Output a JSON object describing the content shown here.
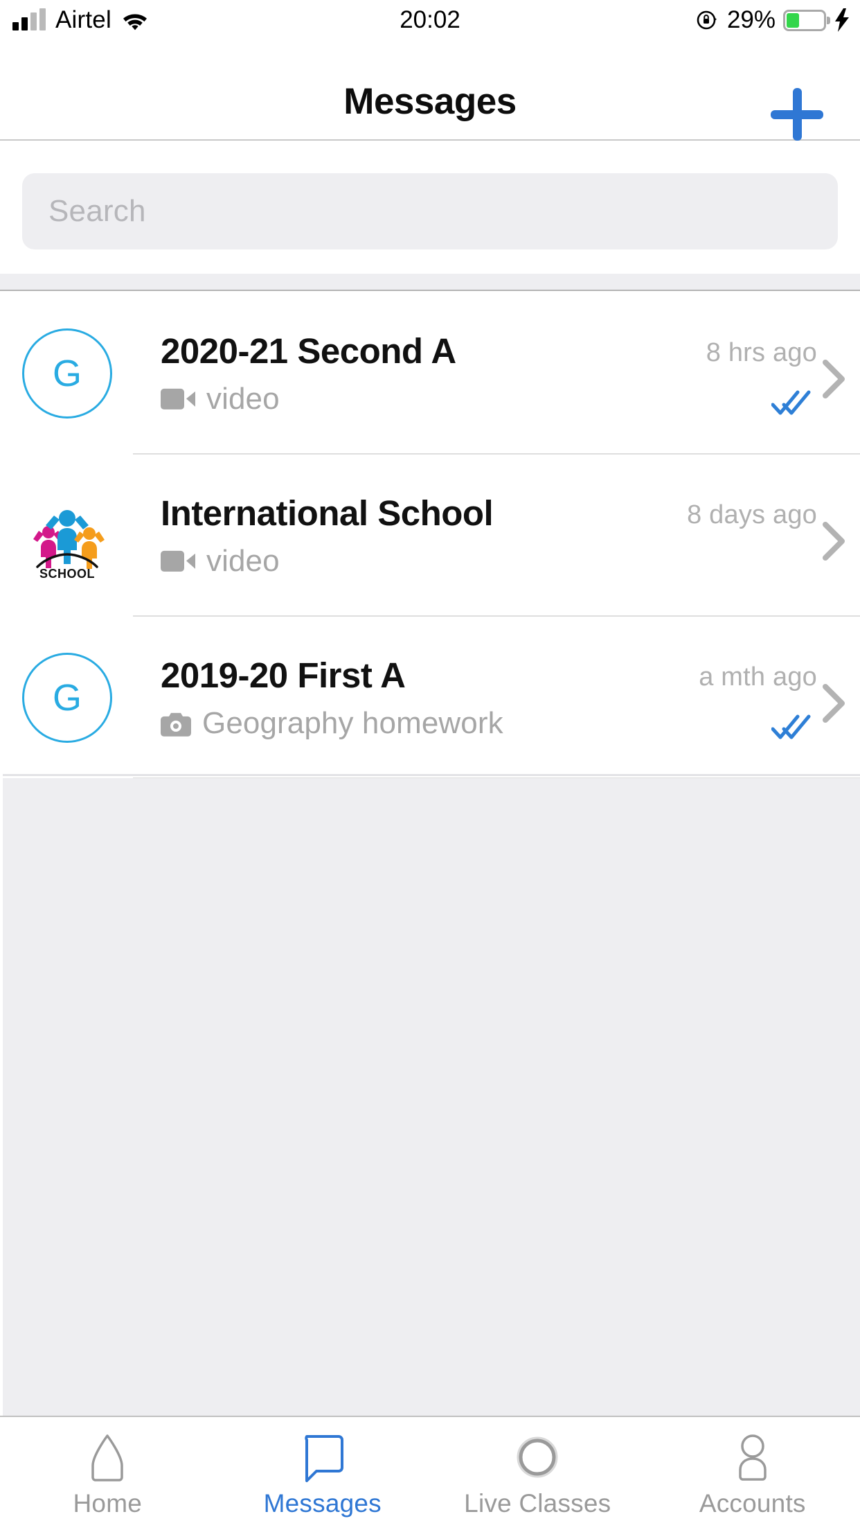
{
  "status_bar": {
    "carrier": "Airtel",
    "wifi_icon": "wifi-icon",
    "time": "20:02",
    "rotation_lock_icon": "rotation-lock-icon",
    "battery_percent": "29%",
    "battery_level": 29,
    "charging_icon": "lightning-bolt-icon"
  },
  "header": {
    "title": "Messages",
    "add_icon": "plus-icon"
  },
  "search": {
    "placeholder": "Search",
    "value": ""
  },
  "chats": [
    {
      "avatar_type": "letter",
      "avatar_letter": "G",
      "title": "2020-21 Second A",
      "attachment_icon": "video-icon",
      "preview": "video",
      "time": "8 hrs ago",
      "read_receipt": "double-check-icon",
      "has_receipt": true,
      "chevron_icon": "chevron-right-icon"
    },
    {
      "avatar_type": "logo",
      "avatar_logo": "school-logo-icon",
      "avatar_logo_text": "SCHOOL",
      "title": "International School",
      "attachment_icon": "video-icon",
      "preview": "video",
      "time": "8 days ago",
      "read_receipt": "",
      "has_receipt": false,
      "chevron_icon": "chevron-right-icon"
    },
    {
      "avatar_type": "letter",
      "avatar_letter": "G",
      "title": "2019-20 First A",
      "attachment_icon": "camera-icon",
      "preview": "Geography homework",
      "time": "a mth ago",
      "read_receipt": "double-check-icon",
      "has_receipt": true,
      "chevron_icon": "chevron-right-icon"
    }
  ],
  "tabbar": {
    "items": [
      {
        "label": "Home",
        "icon": "home-icon",
        "active": false
      },
      {
        "label": "Messages",
        "icon": "chat-bubble-icon",
        "active": true
      },
      {
        "label": "Live Classes",
        "icon": "circle-ring-icon",
        "active": false
      },
      {
        "label": "Accounts",
        "icon": "person-icon",
        "active": false
      }
    ]
  },
  "colors": {
    "accent_blue": "#2f77d4",
    "avatar_blue": "#29abe2",
    "receipt_blue": "#2e7fd6",
    "muted_grey": "#a6a6a6",
    "background_grey": "#eeeef1",
    "battery_green": "#33d64b"
  }
}
